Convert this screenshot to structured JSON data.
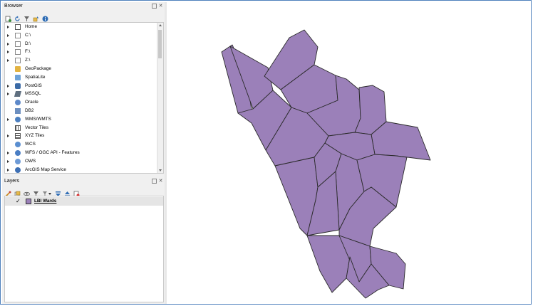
{
  "browser": {
    "title": "Browser",
    "items": [
      {
        "label": "Home",
        "icon": "home-icon",
        "expandable": true
      },
      {
        "label": "C:\\",
        "icon": "folder-icon",
        "expandable": true
      },
      {
        "label": "D:\\",
        "icon": "folder-icon",
        "expandable": true
      },
      {
        "label": "F:\\",
        "icon": "folder-icon",
        "expandable": true
      },
      {
        "label": "Z:\\",
        "icon": "folder-icon",
        "expandable": true
      },
      {
        "label": "GeoPackage",
        "icon": "geopackage-icon",
        "expandable": false
      },
      {
        "label": "SpatiaLite",
        "icon": "spatialite-icon",
        "expandable": false
      },
      {
        "label": "PostGIS",
        "icon": "postgis-icon",
        "expandable": true
      },
      {
        "label": "MSSQL",
        "icon": "mssql-icon",
        "expandable": true
      },
      {
        "label": "Oracle",
        "icon": "oracle-icon",
        "expandable": false
      },
      {
        "label": "DB2",
        "icon": "db2-icon",
        "expandable": false
      },
      {
        "label": "WMS/WMTS",
        "icon": "wms-icon",
        "expandable": true
      },
      {
        "label": "Vector Tiles",
        "icon": "vector-tiles-icon",
        "expandable": false
      },
      {
        "label": "XYZ Tiles",
        "icon": "xyz-tiles-icon",
        "expandable": true
      },
      {
        "label": "WCS",
        "icon": "wcs-icon",
        "expandable": false
      },
      {
        "label": "WFS / OGC API - Features",
        "icon": "wfs-icon",
        "expandable": true
      },
      {
        "label": "OWS",
        "icon": "ows-icon",
        "expandable": true
      },
      {
        "label": "ArcGIS Map Service",
        "icon": "arcgis-icon",
        "expandable": true
      }
    ]
  },
  "layers": {
    "title": "Layers",
    "items": [
      {
        "label": "LBI Wards",
        "checked": true
      }
    ]
  },
  "map": {
    "fill_color": "#9b80b9",
    "stroke_color": "#2a2a2a"
  },
  "colors": {
    "frame_border": "#4f81bd",
    "panel_bg": "#f0f0f0"
  }
}
